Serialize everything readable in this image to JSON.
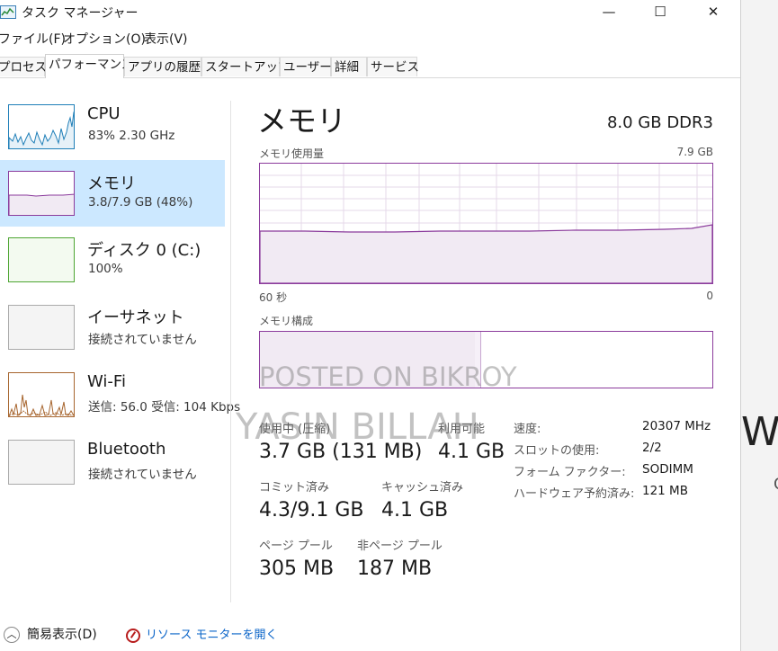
{
  "window": {
    "title": "タスク マネージャー",
    "controls": {
      "minimize": "—",
      "maximize": "☐",
      "close": "✕"
    }
  },
  "menu": [
    "ファイル(F)",
    "オプション(O)",
    "表示(V)"
  ],
  "tabs": [
    "プロセス",
    "パフォーマンス",
    "アプリの履歴",
    "スタートアップ",
    "ユーザー",
    "詳細",
    "サービス"
  ],
  "active_tab": "パフォーマンス",
  "sidebar": [
    {
      "title": "CPU",
      "sub": "83% 2.30 GHz",
      "color": "#1f7fb8"
    },
    {
      "title": "メモリ",
      "sub": "3.8/7.9 GB (48%)",
      "color": "#8b3b9c",
      "selected": true
    },
    {
      "title": "ディスク 0 (C:)",
      "sub": "100%",
      "color": "#4da532"
    },
    {
      "title": "イーサネット",
      "sub": "接続されていません",
      "color": "#aaaaaa"
    },
    {
      "title": "Wi-Fi",
      "sub": "送信: 56.0 受信: 104 Kbps",
      "color": "#a7652e"
    },
    {
      "title": "Bluetooth",
      "sub": "接続されていません",
      "color": "#aaaaaa"
    }
  ],
  "main": {
    "heading": "メモリ",
    "spec": "8.0 GB DDR3",
    "usage_label": "メモリ使用量",
    "usage_max": "7.9 GB",
    "usage_fraction": 0.48,
    "time_left": "60 秒",
    "time_right": "0",
    "composition_label": "メモリ構成",
    "stats": {
      "in_use_label": "使用中 (圧縮)",
      "in_use_value": "3.7 GB (131 MB)",
      "available_label": "利用可能",
      "available_value": "4.1 GB",
      "committed_label": "コミット済み",
      "committed_value": "4.3/9.1 GB",
      "cached_label": "キャッシュ済み",
      "cached_value": "4.1 GB",
      "paged_label": "ページ プール",
      "paged_value": "305 MB",
      "nonpaged_label": "非ページ プール",
      "nonpaged_value": "187 MB"
    },
    "details": [
      {
        "label": "速度:",
        "value": "20307 MHz"
      },
      {
        "label": "スロットの使用:",
        "value": "2/2"
      },
      {
        "label": "フォーム ファクター:",
        "value": "SODIMM"
      },
      {
        "label": "ハードウェア予約済み:",
        "value": "121 MB"
      }
    ]
  },
  "footer": {
    "fewer_details": "簡易表示(D)",
    "resource_monitor": "リソース モニターを開く"
  },
  "watermarks": [
    "POSTED ON BIKROY",
    "YASIN BILLAH"
  ],
  "background_text": {
    "large": "Wh",
    "small": "C"
  }
}
